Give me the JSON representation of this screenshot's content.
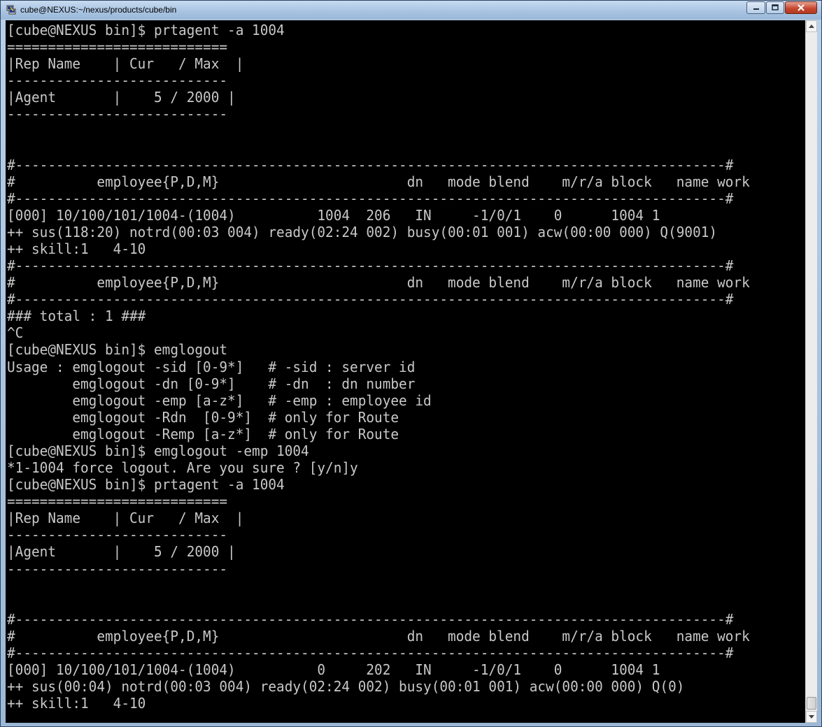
{
  "window": {
    "title": "cube@NEXUS:~/nexus/products/cube/bin",
    "icon": "putty-icon",
    "controls": {
      "minimize": "minimize-icon",
      "maximize": "maximize-icon",
      "close": "close-icon"
    }
  },
  "terminal": {
    "background": "#000000",
    "foreground": "#c8c8c8",
    "lines": [
      "[cube@NEXUS bin]$ prtagent -a 1004",
      "===========================",
      "|Rep Name    | Cur   / Max  |",
      "---------------------------",
      "|Agent       |    5 / 2000 |",
      "---------------------------",
      "",
      "",
      "#---------------------------------------------------------------------------------------#",
      "#          employee{P,D,M}                       dn   mode blend    m/r/a block   name work",
      "#---------------------------------------------------------------------------------------#",
      "[000] 10/100/101/1004-(1004)          1004  206   IN     -1/0/1    0      1004 1",
      "++ sus(118:20) notrd(00:03 004) ready(02:24 002) busy(00:01 001) acw(00:00 000) Q(9001)",
      "++ skill:1   4-10",
      "#---------------------------------------------------------------------------------------#",
      "#          employee{P,D,M}                       dn   mode blend    m/r/a block   name work",
      "#---------------------------------------------------------------------------------------#",
      "### total : 1 ###",
      "^C",
      "[cube@NEXUS bin]$ emglogout",
      "Usage : emglogout -sid [0-9*]   # -sid : server id",
      "        emglogout -dn [0-9*]    # -dn  : dn number",
      "        emglogout -emp [a-z*]   # -emp : employee id",
      "        emglogout -Rdn  [0-9*]  # only for Route",
      "        emglogout -Remp [a-z*]  # only for Route",
      "[cube@NEXUS bin]$ emglogout -emp 1004",
      "*1-1004 force logout. Are you sure ? [y/n]y",
      "[cube@NEXUS bin]$ prtagent -a 1004",
      "===========================",
      "|Rep Name    | Cur   / Max  |",
      "---------------------------",
      "|Agent       |    5 / 2000 |",
      "---------------------------",
      "",
      "",
      "#---------------------------------------------------------------------------------------#",
      "#          employee{P,D,M}                       dn   mode blend    m/r/a block   name work",
      "#---------------------------------------------------------------------------------------#",
      "[000] 10/100/101/1004-(1004)          0     202   IN     -1/0/1    0      1004 1",
      "++ sus(00:04) notrd(00:03 004) ready(02:24 002) busy(00:01 001) acw(00:00 000) Q(0)",
      "++ skill:1   4-10"
    ]
  },
  "scrollbar": {
    "up": "arrow-up-icon",
    "down": "arrow-down-icon",
    "position_fraction": 0.97
  }
}
